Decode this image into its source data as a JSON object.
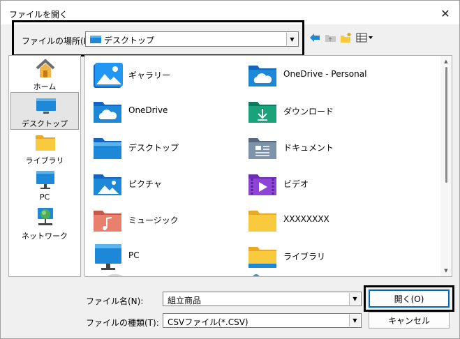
{
  "window": {
    "title": "ファイルを開く",
    "close_glyph": "✕"
  },
  "location": {
    "label": "ファイルの場所(I):",
    "value": "デスクトップ"
  },
  "places": [
    {
      "label": "ホーム",
      "icon": "home-icon"
    },
    {
      "label": "デスクトップ",
      "icon": "desktop-icon",
      "selected": true
    },
    {
      "label": "ライブラリ",
      "icon": "library-folder-icon"
    },
    {
      "label": "PC",
      "icon": "pc-monitor-icon"
    },
    {
      "label": "ネットワーク",
      "icon": "network-icon"
    }
  ],
  "files": [
    {
      "label": "ギャラリー",
      "icon": "gallery-icon"
    },
    {
      "label": "OneDrive - Personal",
      "icon": "onedrive-folder-icon"
    },
    {
      "label": "OneDrive",
      "icon": "onedrive-folder-icon"
    },
    {
      "label": "ダウンロード",
      "icon": "downloads-folder-icon"
    },
    {
      "label": "デスクトップ",
      "icon": "desktop-folder-icon"
    },
    {
      "label": "ドキュメント",
      "icon": "documents-folder-icon"
    },
    {
      "label": "ピクチャ",
      "icon": "pictures-folder-icon"
    },
    {
      "label": "ビデオ",
      "icon": "videos-folder-icon"
    },
    {
      "label": "ミュージック",
      "icon": "music-folder-icon"
    },
    {
      "label": "XXXXXXXX",
      "icon": "folder-icon"
    },
    {
      "label": "PC",
      "icon": "pc-monitor-icon"
    },
    {
      "label": "ライブラリ",
      "icon": "library-folder-icon"
    }
  ],
  "filename": {
    "label": "ファイル名(N):",
    "value": "組立商品"
  },
  "filetype": {
    "label": "ファイルの種類(T):",
    "value": "CSVファイル(*.CSV)"
  },
  "buttons": {
    "open": "開く(O)",
    "cancel": "キャンセル"
  },
  "colors": {
    "folder_yellow": "#f9c93e",
    "folder_blue": "#1e88d8",
    "default_button_border": "#0067c0"
  }
}
